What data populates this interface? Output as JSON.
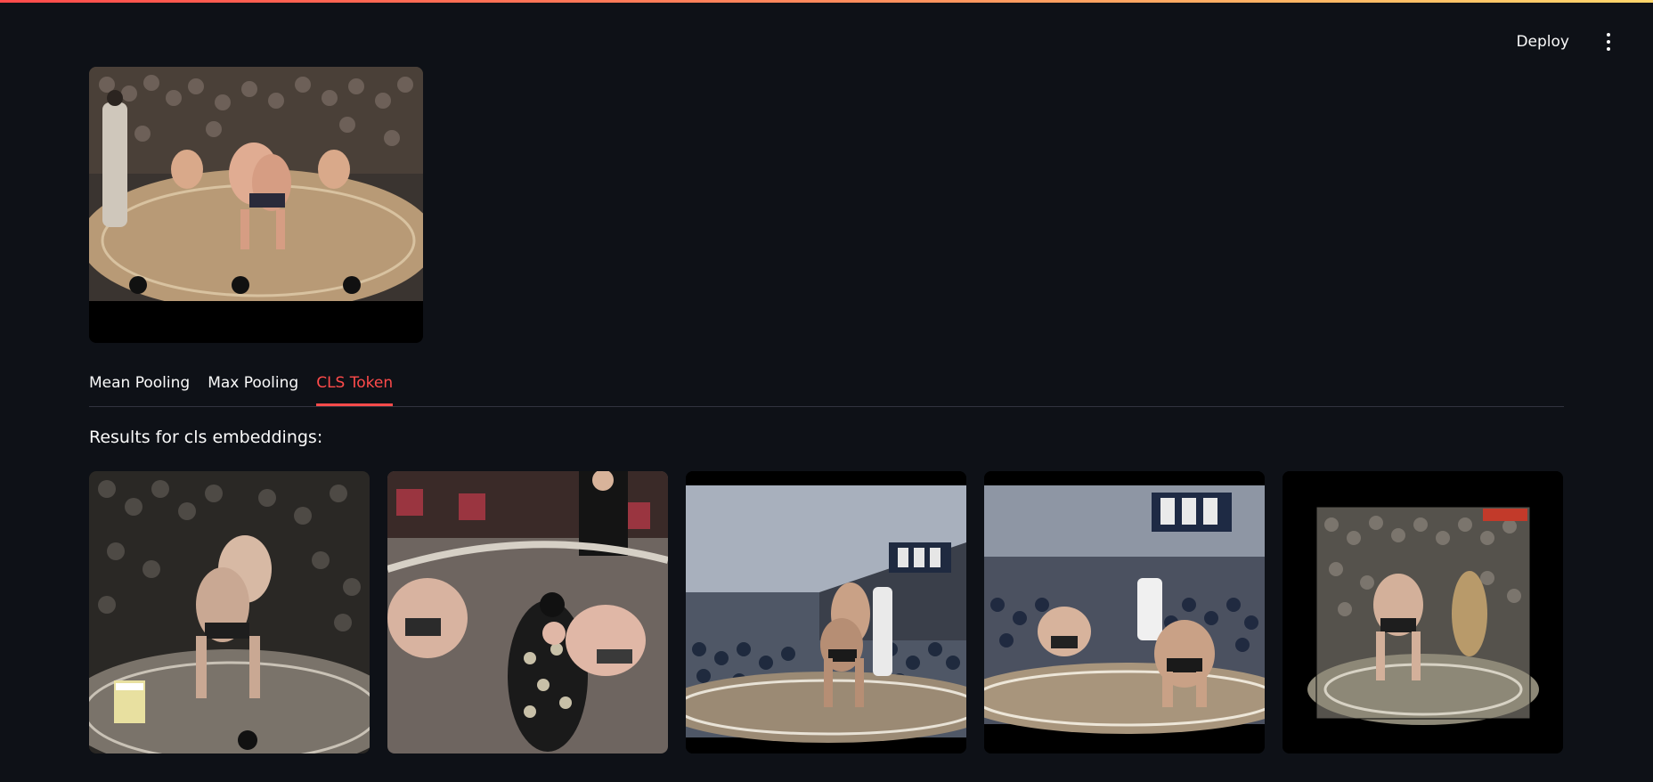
{
  "header": {
    "deploy_label": "Deploy",
    "menu_icon": "more-vertical-icon"
  },
  "query_video": {
    "icon": "video-player"
  },
  "tabs": [
    {
      "label": "Mean Pooling",
      "active": false
    },
    {
      "label": "Max Pooling",
      "active": false
    },
    {
      "label": "CLS Token",
      "active": true
    }
  ],
  "results": {
    "heading": "Results for cls embeddings:",
    "items": [
      {
        "kind": "video-thumbnail"
      },
      {
        "kind": "video-thumbnail"
      },
      {
        "kind": "video-thumbnail"
      },
      {
        "kind": "video-thumbnail"
      },
      {
        "kind": "video-thumbnail"
      }
    ]
  },
  "colors": {
    "background": "#0e1117",
    "accent": "#ff4b4b",
    "text": "#fafafa",
    "divider": "#31333f"
  }
}
